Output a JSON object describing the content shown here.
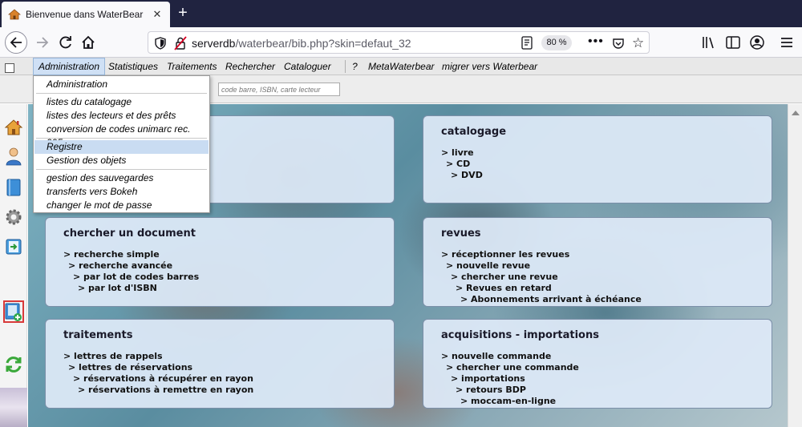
{
  "browser": {
    "tab_title": "Bienvenue dans WaterBear",
    "tab_close": "✕",
    "new_tab": "+",
    "url_host": "serverdb",
    "url_path": "/waterbear/bib.php?skin=defaut_32",
    "zoom": "80 %",
    "more": "•••"
  },
  "menubar": {
    "items": [
      "Administration",
      "Statistiques",
      "Traitements",
      "Rechercher",
      "Cataloguer",
      "?",
      "MetaWaterbear",
      "migrer vers Waterbear"
    ]
  },
  "search": {
    "placeholder": "code barre, ISBN, carte lecteur"
  },
  "dropdown": {
    "items": [
      "Administration",
      "listes du catalogage",
      "listes des lecteurs et des prêts",
      "conversion de codes unimarc rec. 995",
      "Registre",
      "Gestion des objets",
      "gestion des sauvegardes",
      "transferts vers Bokeh",
      "changer le mot de passe"
    ]
  },
  "panels": {
    "catalogage": {
      "title": "catalogage",
      "items": [
        "> livre",
        "> CD",
        "> DVD"
      ]
    },
    "chercher": {
      "title": "chercher un document",
      "items": [
        "> recherche simple",
        "> recherche avancée",
        "> par lot de codes barres",
        "> par lot d'ISBN"
      ]
    },
    "revues": {
      "title": "revues",
      "items": [
        "> réceptionner les revues",
        "> nouvelle revue",
        "> chercher une revue",
        "> Revues en retard",
        "> Abonnements arrivant à échéance"
      ]
    },
    "traitements": {
      "title": "traitements",
      "items": [
        "> lettres de rappels",
        "> lettres de réservations",
        "> réservations à récupérer en rayon",
        "> réservations à remettre en rayon"
      ]
    },
    "acquisitions": {
      "title": "acquisitions - importations",
      "items": [
        "> nouvelle commande",
        "> chercher une commande",
        "> importations",
        "> retours BDP",
        "> moccam-en-ligne"
      ]
    }
  }
}
